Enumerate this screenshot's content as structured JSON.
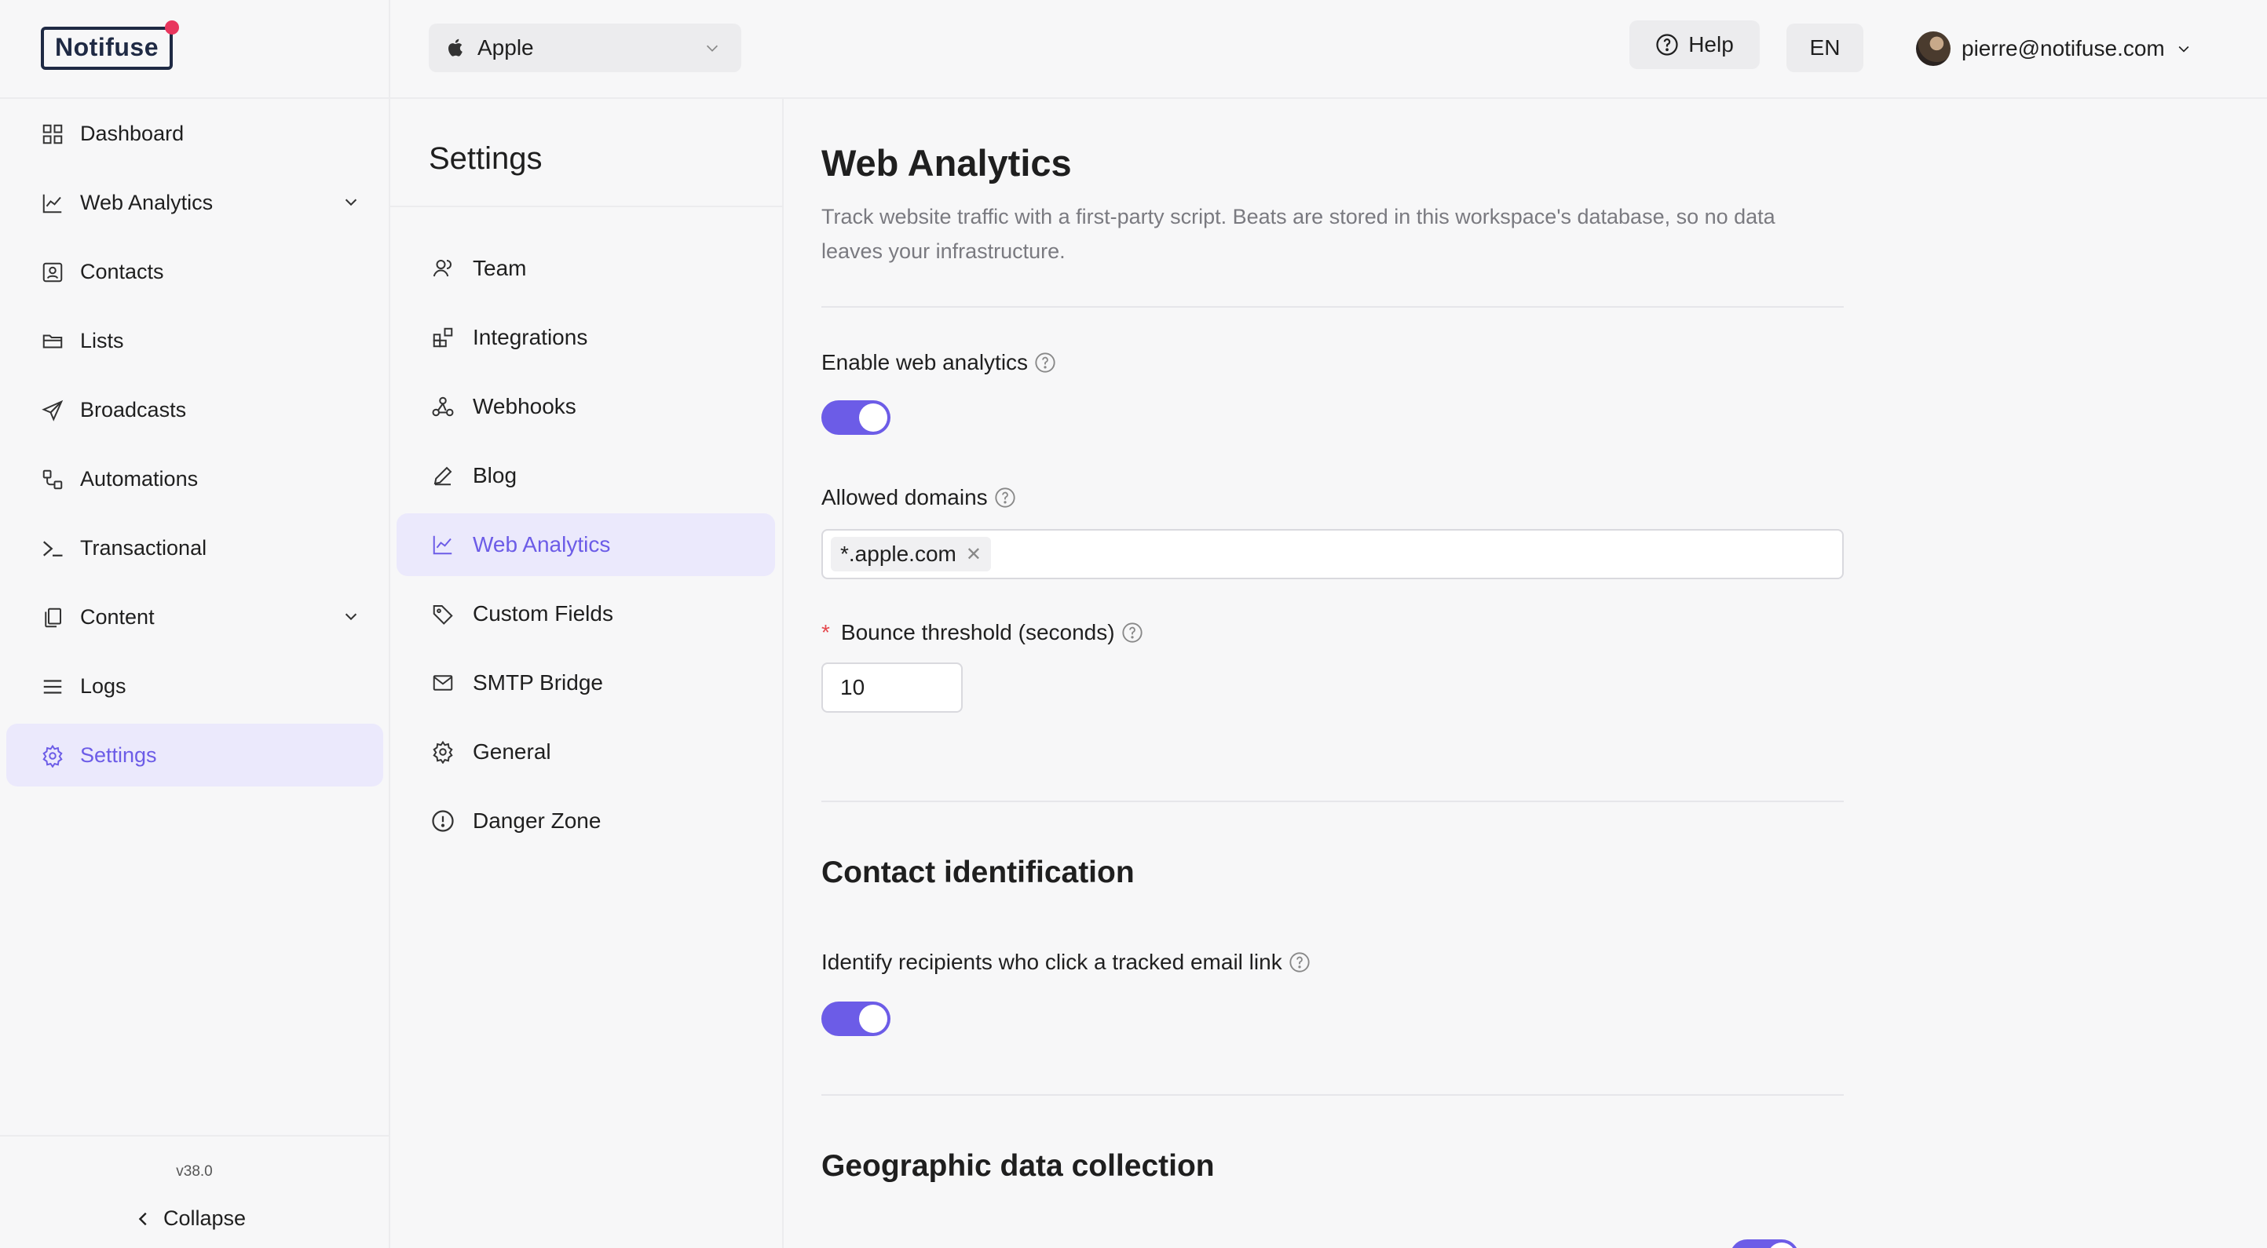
{
  "app": {
    "logo_text": "Notifuse",
    "version": "v38.0",
    "collapse_label": "Collapse"
  },
  "sidebar": {
    "items": [
      {
        "label": "Dashboard",
        "icon": "dashboard-grid-icon"
      },
      {
        "label": "Web Analytics",
        "icon": "line-chart-icon",
        "expandable": true
      },
      {
        "label": "Contacts",
        "icon": "contact-card-icon"
      },
      {
        "label": "Lists",
        "icon": "folder-open-icon"
      },
      {
        "label": "Broadcasts",
        "icon": "paper-plane-icon"
      },
      {
        "label": "Automations",
        "icon": "workflow-icon"
      },
      {
        "label": "Transactional",
        "icon": "terminal-prompt-icon"
      },
      {
        "label": "Content",
        "icon": "copy-documents-icon",
        "expandable": true
      },
      {
        "label": "Logs",
        "icon": "list-lines-icon"
      },
      {
        "label": "Settings",
        "icon": "gear-icon",
        "active": true
      }
    ]
  },
  "topbar": {
    "workspace": "Apple",
    "help_label": "Help",
    "language": "EN",
    "user_email": "pierre@notifuse.com"
  },
  "settings_menu": {
    "title": "Settings",
    "items": [
      {
        "label": "Team",
        "icon": "team-icon"
      },
      {
        "label": "Integrations",
        "icon": "integrations-icon"
      },
      {
        "label": "Webhooks",
        "icon": "webhook-icon"
      },
      {
        "label": "Blog",
        "icon": "pen-icon"
      },
      {
        "label": "Web Analytics",
        "icon": "line-chart-icon",
        "active": true
      },
      {
        "label": "Custom Fields",
        "icon": "tag-icon"
      },
      {
        "label": "SMTP Bridge",
        "icon": "mail-icon"
      },
      {
        "label": "General",
        "icon": "gear-icon"
      },
      {
        "label": "Danger Zone",
        "icon": "alert-circle-icon"
      }
    ]
  },
  "main": {
    "title": "Web Analytics",
    "description": "Track website traffic with a first-party script. Beats are stored in this workspace's database, so no data leaves your infrastructure.",
    "enable_label": "Enable web analytics",
    "enable_on": true,
    "allowed_domains_label": "Allowed domains",
    "allowed_domains": [
      "*.apple.com"
    ],
    "bounce_label": "Bounce threshold (seconds)",
    "bounce_required_mark": "*",
    "bounce_value": "10",
    "contact_section_title": "Contact identification",
    "identify_label": "Identify recipients who click a tracked email link",
    "identify_on": true,
    "geo_section_title": "Geographic data collection"
  },
  "colors": {
    "accent": "#6c5ce7",
    "accent_bg": "#ebe9fc",
    "logo_dot": "#e8365d",
    "required": "#e5484d"
  }
}
